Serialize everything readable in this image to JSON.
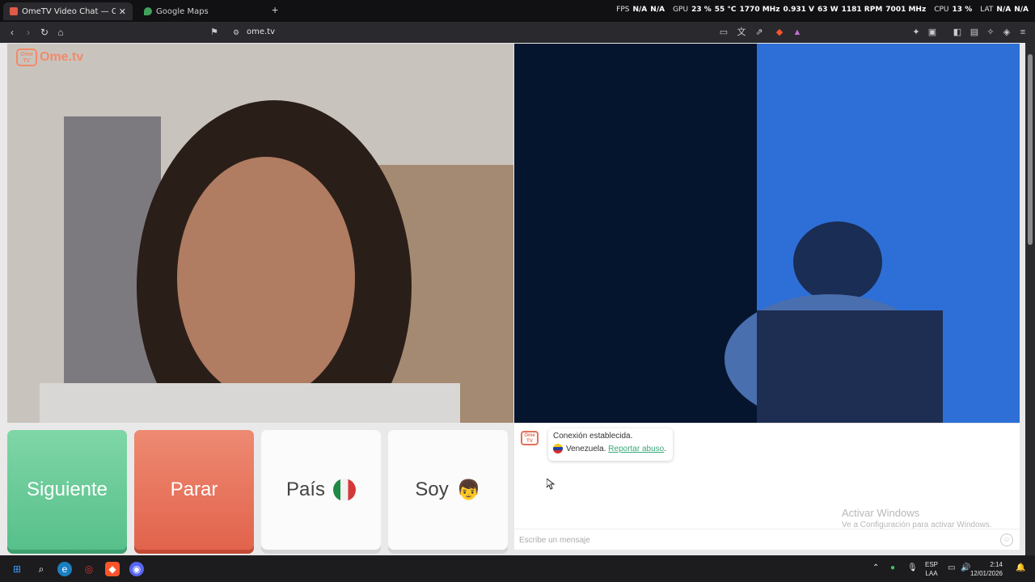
{
  "browser": {
    "tabs": [
      {
        "title": "OmeTV Video Chat — Omeg",
        "active": true
      },
      {
        "title": "Google Maps",
        "active": false
      }
    ],
    "url": "ome.tv",
    "overlay": {
      "fps_label": "FPS",
      "fps1": "N/A",
      "fps2": "N/A",
      "gpu_label": "GPU",
      "gpu_pct": "23 %",
      "gpu_temp": "55 °C",
      "gpu_clock": "1770 MHz",
      "gpu_volt": "0.931 V",
      "gpu_power": "63 W",
      "gpu_rpm": "1181 RPM",
      "gpu_mem": "7001 MHz",
      "cpu_label": "CPU",
      "cpu_pct": "13 %",
      "lat_label": "LAT",
      "lat1": "N/A",
      "lat2": "N/A"
    }
  },
  "site": {
    "logo_box": "Ome TV",
    "logo_text": "Ome.tv"
  },
  "controls": {
    "next": "Siguiente",
    "stop": "Parar",
    "country": "País",
    "soy": "Soy"
  },
  "chat": {
    "logo_box": "Ome TV",
    "connected": "Conexión establecida.",
    "country": "Venezuela.",
    "report": "Reportar abuso",
    "report_suffix": ".",
    "placeholder": "Escribe un mensaje",
    "activate_title": "Activar Windows",
    "activate_sub": "Ve a Configuración para activar Windows."
  },
  "taskbar": {
    "lang1": "ESP",
    "lang2": "LAA",
    "time": "2:14",
    "date": "12/01/2026"
  },
  "colors": {
    "next": "#5dc490",
    "stop": "#e5694f",
    "accent_link": "#3aa878",
    "ometv_orange": "#f28a6a"
  }
}
